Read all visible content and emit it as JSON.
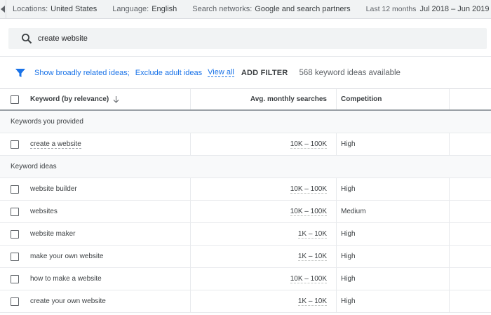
{
  "topbar": {
    "location_label": "Locations:",
    "location_value": "United States",
    "language_label": "Language:",
    "language_value": "English",
    "network_label": "Search networks:",
    "network_value": "Google and search partners",
    "date_label": "Last 12 months",
    "date_value": "Jul 2018 – Jun 2019"
  },
  "search": {
    "value": "create website"
  },
  "filters": {
    "broad_label": "Show broadly related ideas;",
    "adult_label": "Exclude adult ideas",
    "view_all_label": "View all",
    "add_filter_label": "ADD FILTER",
    "count_text": "568 keyword ideas available"
  },
  "table": {
    "headers": {
      "keyword": "Keyword (by relevance)",
      "avg": "Avg. monthly searches",
      "competition": "Competition"
    },
    "provided_group": "Keywords you provided",
    "provided": [
      {
        "keyword": "create a website",
        "avg": "10K – 100K",
        "competition": "High"
      }
    ],
    "ideas_group": "Keyword ideas",
    "ideas": [
      {
        "keyword": "website builder",
        "avg": "10K – 100K",
        "competition": "High"
      },
      {
        "keyword": "websites",
        "avg": "10K – 100K",
        "competition": "Medium"
      },
      {
        "keyword": "website maker",
        "avg": "1K – 10K",
        "competition": "High"
      },
      {
        "keyword": "make your own website",
        "avg": "1K – 10K",
        "competition": "High"
      },
      {
        "keyword": "how to make a website",
        "avg": "10K – 100K",
        "competition": "High"
      },
      {
        "keyword": "create your own website",
        "avg": "1K – 10K",
        "competition": "High"
      }
    ]
  },
  "icons": {
    "back": "chevron-left-icon",
    "dropdown": "caret-down-icon",
    "search": "search-icon",
    "filter": "filter-funnel-icon",
    "sort": "arrow-down-icon"
  },
  "colors": {
    "link": "#1a73e8",
    "bar_bg": "#f1f3f4"
  }
}
